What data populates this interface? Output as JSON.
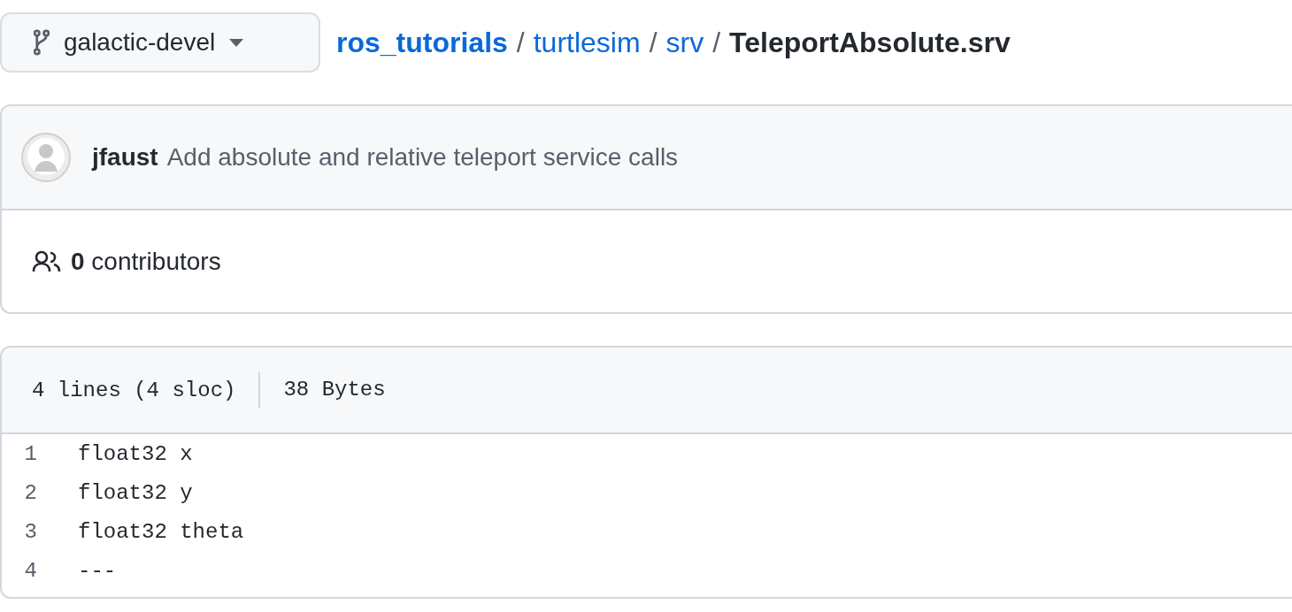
{
  "branch": {
    "name": "galactic-devel"
  },
  "breadcrumb": {
    "links": [
      "ros_tutorials",
      "turtlesim",
      "srv"
    ],
    "separator": "/",
    "current": "TeleportAbsolute.srv"
  },
  "commit": {
    "author": "jfaust",
    "message": "Add absolute and relative teleport service calls"
  },
  "contributors": {
    "text": "**0** contributors"
  },
  "file": {
    "lines_info": "4 lines (4 sloc)",
    "size": "38 Bytes",
    "lines": [
      {
        "number": "1",
        "code": "float32 x"
      },
      {
        "number": "2",
        "code": "float32 y"
      },
      {
        "number": "3",
        "code": "float32 theta"
      },
      {
        "number": "4",
        "code": "---"
      }
    ]
  }
}
